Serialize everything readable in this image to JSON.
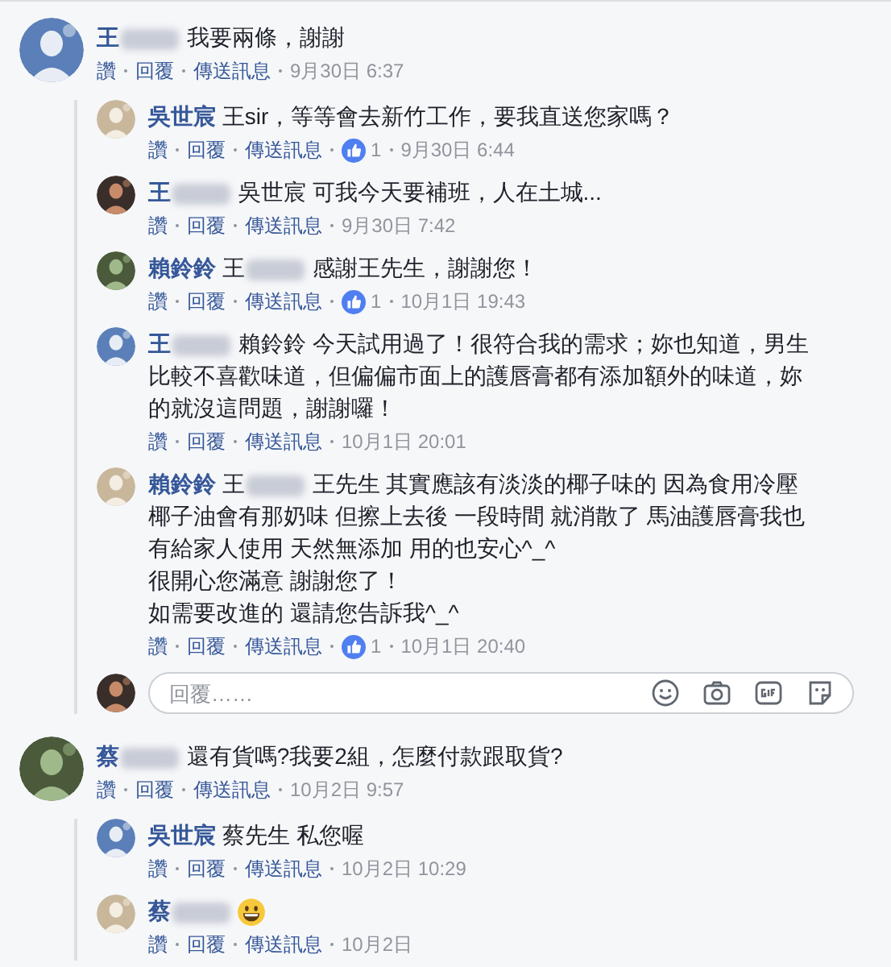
{
  "threads": [
    {
      "author": {
        "name": "王",
        "redacted": true
      },
      "text": "我要兩條，謝謝",
      "actions": [
        "讚",
        "回覆",
        "傳送訊息"
      ],
      "time": "9月30日 6:37",
      "replies": [
        {
          "author": {
            "name": "吳世宸",
            "redacted": false
          },
          "text": "王sir，等等會去新竹工作，要我直送您家嗎？",
          "actions": [
            "讚",
            "回覆",
            "傳送訊息"
          ],
          "likes": "1",
          "time": "9月30日 6:44"
        },
        {
          "author": {
            "name": "王",
            "redacted": true
          },
          "text": "吳世宸 可我今天要補班，人在土城...",
          "actions": [
            "讚",
            "回覆",
            "傳送訊息"
          ],
          "time": "9月30日 7:42"
        },
        {
          "author": {
            "name": "賴鈴鈴",
            "redacted": false
          },
          "mention": {
            "name": "王",
            "redacted": true
          },
          "text": "感謝王先生，謝謝您！",
          "actions": [
            "讚",
            "回覆",
            "傳送訊息"
          ],
          "likes": "1",
          "time": "10月1日 19:43"
        },
        {
          "author": {
            "name": "王",
            "redacted": true
          },
          "text": "賴鈴鈴 今天試用過了！很符合我的需求；妳也知道，男生比較不喜歡味道，但偏偏市面上的護唇膏都有添加額外的味道，妳的就沒這問題，謝謝囉！",
          "actions": [
            "讚",
            "回覆",
            "傳送訊息"
          ],
          "time": "10月1日 20:01"
        },
        {
          "author": {
            "name": "賴鈴鈴",
            "redacted": false
          },
          "mention": {
            "name": "王",
            "redacted": true
          },
          "text": "王先生 其實應該有淡淡的椰子味的 因為食用冷壓椰子油會有那奶味 但擦上去後 一段時間 就消散了 馬油護唇膏我也有給家人使用 天然無添加 用的也安心^_^",
          "extra_lines": [
            "很開心您滿意 謝謝您了！",
            "如需要改進的 還請您告訴我^_^"
          ],
          "actions": [
            "讚",
            "回覆",
            "傳送訊息"
          ],
          "likes": "1",
          "time": "10月1日 20:40"
        }
      ],
      "reply_box": {
        "placeholder": "回覆……"
      }
    },
    {
      "author": {
        "name": "蔡",
        "redacted": true
      },
      "text": "還有貨嗎?我要2組，怎麼付款跟取貨?",
      "actions": [
        "讚",
        "回覆",
        "傳送訊息"
      ],
      "time": "10月2日 9:57",
      "replies": [
        {
          "author": {
            "name": "吳世宸",
            "redacted": false
          },
          "text": "蔡先生 私您喔",
          "actions": [
            "讚",
            "回覆",
            "傳送訊息"
          ],
          "time": "10月2日 10:29"
        },
        {
          "author": {
            "name": "蔡",
            "redacted": true
          },
          "emoji": true,
          "actions": [
            "讚",
            "回覆",
            "傳送訊息"
          ],
          "time": "10月2日"
        }
      ]
    }
  ]
}
